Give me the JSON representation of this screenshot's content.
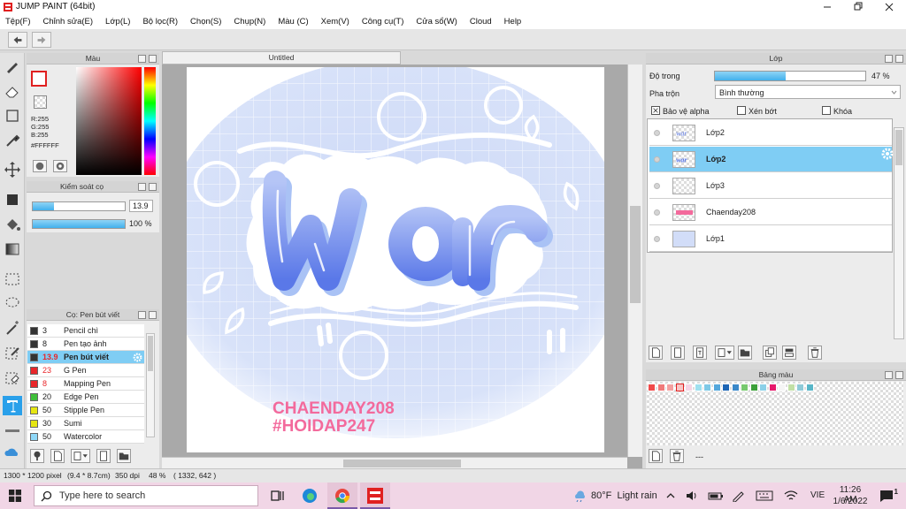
{
  "window": {
    "title": "JUMP PAINT (64bit)"
  },
  "menu": [
    "Tệp(F)",
    "Chỉnh sửa(E)",
    "Lớp(L)",
    "Bộ lọc(R)",
    "Chọn(S)",
    "Chụp(N)",
    "Màu (C)",
    "Xem(V)",
    "Công cụ(T)",
    "Cửa sổ(W)",
    "Cloud",
    "Help"
  ],
  "color_panel": {
    "title": "Màu",
    "r": "R:255",
    "g": "G:255",
    "b": "B:255",
    "hex": "#FFFFFF"
  },
  "brush_panel": {
    "title": "Kiểm soát cọ",
    "size": "13.9",
    "size_fraction": 0.23,
    "opacity": "100 %",
    "opacity_fraction": 1.0
  },
  "pen_panel": {
    "title": "Cọ: Pen bút viết",
    "items": [
      {
        "size": "3",
        "name": "Pencil chì",
        "color": "#333333"
      },
      {
        "size": "8",
        "name": "Pen tạo ảnh",
        "color": "#333333"
      },
      {
        "size": "13.9",
        "name": "Pen bút viết",
        "color": "#333333",
        "selected": true
      },
      {
        "size": "23",
        "name": "G Pen",
        "color": "#e8262a"
      },
      {
        "size": "8",
        "name": "Mapping Pen",
        "color": "#e8262a"
      },
      {
        "size": "20",
        "name": "Edge Pen",
        "color": "#3fbf3a"
      },
      {
        "size": "50",
        "name": "Stipple Pen",
        "color": "#e6e612"
      },
      {
        "size": "30",
        "name": "Sumi",
        "color": "#e6e612"
      },
      {
        "size": "50",
        "name": "Watercolor",
        "color": "#8fd8f8"
      }
    ]
  },
  "canvas": {
    "tab_title": "Untitled",
    "signature_line1": "CHAENDAY208",
    "signature_line2": "#HOIDAP247",
    "lettering": "war"
  },
  "layer_panel": {
    "title": "Lớp",
    "opacity_label": "Độ trong",
    "opacity_value": "47 %",
    "opacity_fraction": 0.47,
    "blend_label": "Pha trộn",
    "blend_value": "Bình thường",
    "protect_alpha": "Bảo vệ alpha",
    "clipping": "Xén bớt",
    "lock": "Khóa",
    "layers": [
      {
        "name": "Lớp2",
        "thumb": "war"
      },
      {
        "name": "Lớp2",
        "thumb": "war",
        "selected": true
      },
      {
        "name": "Lớp3",
        "thumb": "empty"
      },
      {
        "name": "Chaenday208",
        "thumb": "text"
      },
      {
        "name": "Lớp1",
        "thumb": "bg"
      }
    ]
  },
  "palette_panel": {
    "title": "Bảng màu",
    "footer": "---",
    "colors": [
      "#f04a4a",
      "#f07a7a",
      "#f4a0a0",
      "#f7c5c5",
      "#f5d5e5",
      "#9fe0ef",
      "#7ec9e6",
      "#55a8dc",
      "#1e66b5",
      "#3b88c9",
      "#78c96f",
      "#3da03a",
      "#8bd0e8",
      "#e6196b",
      "#f5f5f5",
      "#c2e0a6",
      "#8fcad8",
      "#58b6c8"
    ]
  },
  "status": {
    "size": "1300 * 1200 pixel",
    "cm": "(9.4 * 8.7cm)",
    "dpi": "350 dpi",
    "zoom": "48 %",
    "coords": "( 1332, 642 )"
  },
  "taskbar": {
    "search_placeholder": "Type here to search",
    "weather": "80°F  Light rain",
    "lang": "VIE",
    "time": "11:26 AM",
    "date": "1/6/2022",
    "notif_count": "1"
  }
}
